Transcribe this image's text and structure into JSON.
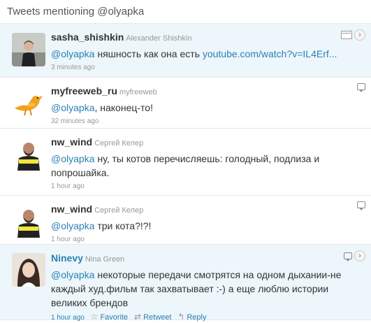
{
  "header": {
    "title": "Tweets mentioning @olyapka"
  },
  "tweets": [
    {
      "screen_name": "sasha_shishkin",
      "real_name": "Alexander Shishkin",
      "mention": "@olyapka",
      "text": " няшность как она есть ",
      "link": "youtube.com/watch?v=IL4Erf...",
      "time": "3 minutes ago"
    },
    {
      "screen_name": "myfreeweb_ru",
      "real_name": "myfreeweb",
      "mention": "@olyapka",
      "text": ", наконец-то!",
      "time": "32 minutes ago"
    },
    {
      "screen_name": "nw_wind",
      "real_name": "Сергей Келер",
      "mention": "@olyapka",
      "text": " ну, ты котов перечисляешь: голодный, подлиза и попрошайка.",
      "time": "1 hour ago"
    },
    {
      "screen_name": "nw_wind",
      "real_name": "Сергей Келер",
      "mention": "@olyapka",
      "text": " три кота?!?!",
      "time": "1 hour ago"
    },
    {
      "screen_name": "Ninevy",
      "real_name": "Nina Green",
      "mention": "@olyapka",
      "text": " некоторые передачи смотрятся на одном дыхании-не каждый худ.фильм так захватывает :-) а еще люблю истории великих брендов",
      "time": "1 hour ago",
      "actions": {
        "favorite": "Favorite",
        "retweet": "Retweet",
        "reply": "Reply"
      }
    }
  ],
  "icons": {
    "media": "media-icon",
    "expand": "chevron-right-icon",
    "reply_bubble": "reply-bubble-icon",
    "favorite": "star-icon",
    "retweet": "retweet-icon",
    "reply": "reply-arrow-icon"
  },
  "colors": {
    "link": "#2b80b4",
    "active_row_bg": "#ecf6fb",
    "meta": "#999999"
  }
}
